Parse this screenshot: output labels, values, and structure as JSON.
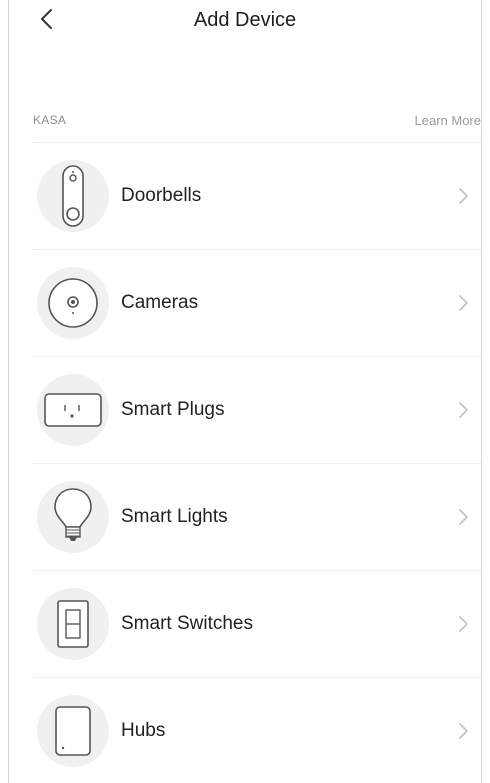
{
  "header": {
    "title": "Add Device"
  },
  "section": {
    "label": "KASA",
    "learn_more": "Learn More"
  },
  "devices": [
    {
      "label": "Doorbells",
      "icon": "doorbell-icon"
    },
    {
      "label": "Cameras",
      "icon": "camera-icon"
    },
    {
      "label": "Smart Plugs",
      "icon": "smart-plug-icon"
    },
    {
      "label": "Smart Lights",
      "icon": "light-bulb-icon"
    },
    {
      "label": "Smart Switches",
      "icon": "light-switch-icon"
    },
    {
      "label": "Hubs",
      "icon": "hub-icon"
    }
  ],
  "colors": {
    "text": "#222222",
    "muted": "#8d8d8d",
    "icon_bg": "#f0f0f0",
    "divider": "#eeeeee",
    "chevron": "#c4c4c4"
  }
}
